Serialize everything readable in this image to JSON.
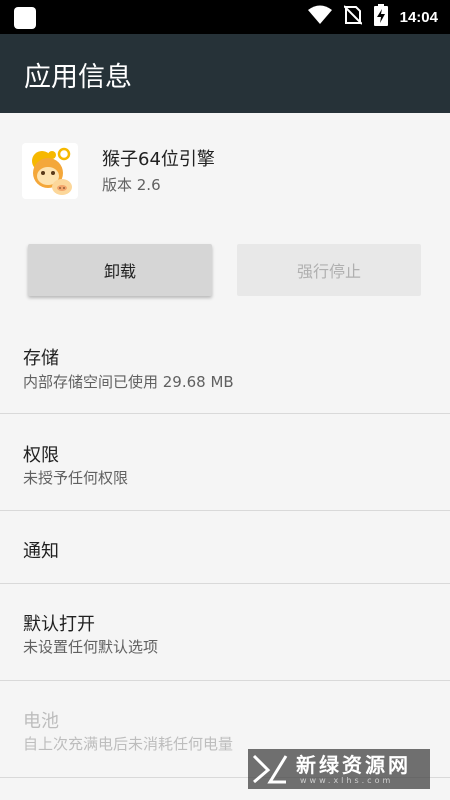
{
  "status_bar": {
    "time": "14:04",
    "icons": [
      "notification-square-icon",
      "wifi-icon",
      "no-sim-icon",
      "battery-charging-icon"
    ]
  },
  "appbar": {
    "title": "应用信息"
  },
  "app": {
    "name": "猴子64位引擎",
    "version": "版本 2.6",
    "icon": "monkey-app-icon"
  },
  "buttons": {
    "uninstall": "卸载",
    "force_stop": "强行停止"
  },
  "sections": {
    "storage": {
      "title": "存储",
      "subtitle": "内部存储空间已使用 29.68 MB"
    },
    "permissions": {
      "title": "权限",
      "subtitle": "未授予任何权限"
    },
    "notifications": {
      "title": "通知"
    },
    "open_by_default": {
      "title": "默认打开",
      "subtitle": "未设置任何默认选项"
    },
    "battery": {
      "title": "电池",
      "subtitle": "自上次充满电后未消耗任何电量"
    }
  },
  "watermark": {
    "text": "新绿资源网",
    "sub": "www.xlhs.com"
  },
  "colors": {
    "appbar": "#263238",
    "background": "#f5f5f5",
    "statusbar": "#000000"
  }
}
